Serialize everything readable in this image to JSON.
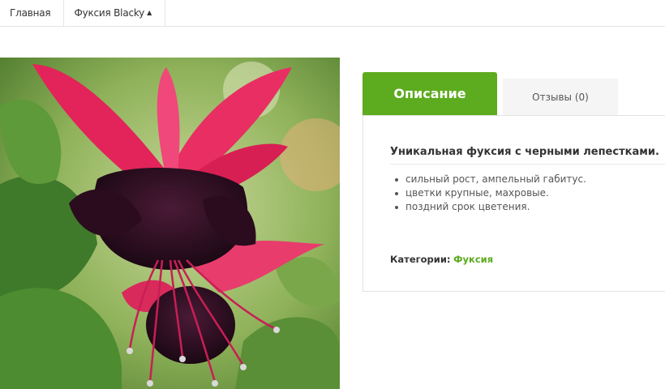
{
  "breadcrumb": {
    "home": "Главная",
    "current": "Фуксия Blacky",
    "caret_icon": "caret-up-icon"
  },
  "product": {
    "image_alt": "Фуксия Blacky"
  },
  "tabs": {
    "description": "Описание",
    "reviews": "Отзывы (0)"
  },
  "description": {
    "title": "Уникальная фуксия с черными лепестками.",
    "features": [
      "сильный рост, ампельный габитус.",
      "цветки крупные, махровые.",
      "поздний срок цветения."
    ],
    "categories_label": "Категории:",
    "category_link": "Фуксия"
  },
  "colors": {
    "accent": "#5dab1e",
    "petal": "#e0245e",
    "corolla": "#2a0f20",
    "leaf": "#4f8a2e"
  }
}
